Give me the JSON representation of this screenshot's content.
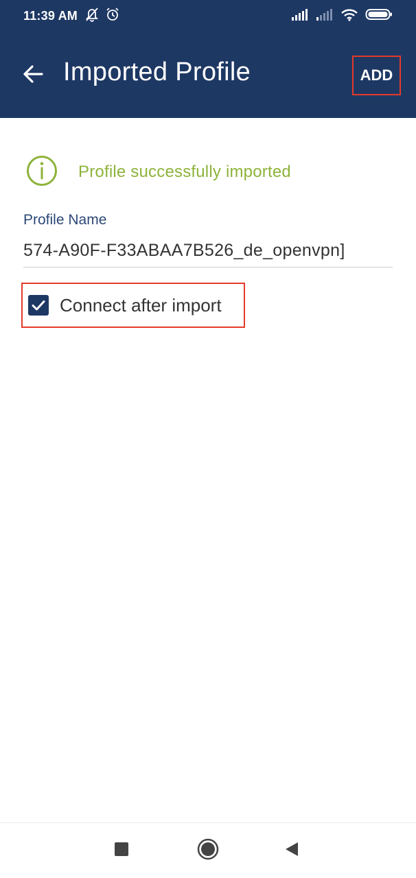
{
  "status_bar": {
    "time": "11:39 AM",
    "icons": [
      "notifications-off-icon",
      "alarm-icon",
      "signal-icon",
      "signal-weak-icon",
      "wifi-icon",
      "battery-icon"
    ]
  },
  "app_bar": {
    "title": "Imported Profile",
    "add_label": "ADD",
    "back_icon": "arrow-left-icon"
  },
  "status_message": {
    "text": "Profile successfully imported",
    "icon": "info-icon",
    "color": "#8db33a"
  },
  "profile_field": {
    "label": "Profile Name",
    "value": "574-A90F-F33ABAA7B526_de_openvpn]"
  },
  "connect_checkbox": {
    "label": "Connect after import",
    "checked": true
  },
  "colors": {
    "primary": "#1e3864",
    "highlight": "#e53a2a",
    "success": "#8db33a"
  },
  "nav_bar": {
    "icons": [
      "recent-apps-icon",
      "home-icon",
      "back-triangle-icon"
    ]
  }
}
